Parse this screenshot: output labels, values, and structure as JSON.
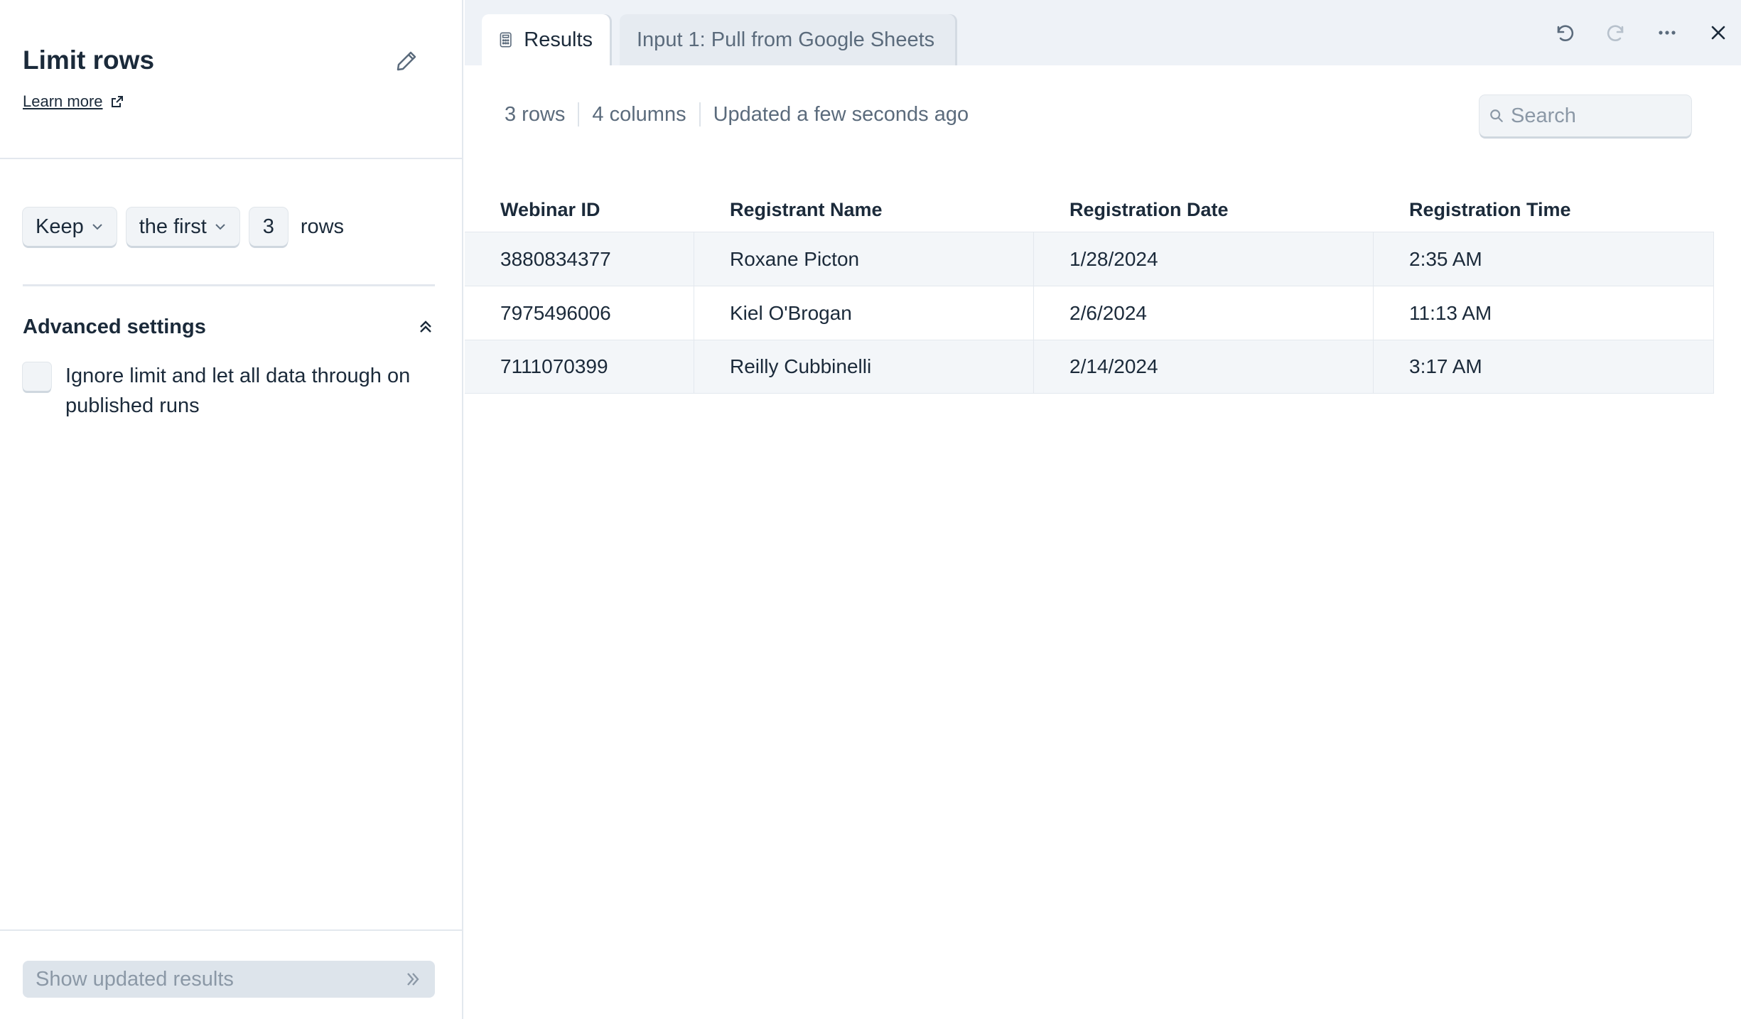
{
  "panel": {
    "title": "Limit rows",
    "learn_more": "Learn more",
    "config": {
      "mode": "Keep",
      "position": "the first",
      "count": "3",
      "unit": "rows"
    },
    "advanced": {
      "title": "Advanced settings",
      "checkbox_label": "Ignore limit and let all data through on published runs",
      "checked": false
    },
    "footer_button": "Show updated results"
  },
  "tabs": [
    {
      "label": "Results",
      "icon": "calculator-icon",
      "active": true
    },
    {
      "label": "Input 1: Pull from Google Sheets",
      "active": false
    }
  ],
  "toolbar": {
    "icons": [
      "undo-icon",
      "redo-icon",
      "more-icon",
      "close-icon"
    ]
  },
  "summary": {
    "rows": "3 rows",
    "columns": "4 columns",
    "updated": "Updated a few seconds ago"
  },
  "search": {
    "placeholder": "Search",
    "value": ""
  },
  "table": {
    "headers": [
      "Webinar ID",
      "Registrant Name",
      "Registration Date",
      "Registration Time"
    ],
    "rows": [
      [
        "3880834377",
        "Roxane Picton",
        "1/28/2024",
        "2:35 AM"
      ],
      [
        "7975496006",
        "Kiel O'Brogan",
        "2/6/2024",
        "11:13 AM"
      ],
      [
        "7111070399",
        "Reilly Cubbinelli",
        "2/14/2024",
        "3:17 AM"
      ]
    ]
  },
  "colors": {
    "text": "#1b2a3a",
    "muted": "#5b6b7c",
    "topbar_bg": "#eef2f7",
    "row_alt": "#f3f6f9",
    "disabled_btn_bg": "#dde4eb"
  }
}
